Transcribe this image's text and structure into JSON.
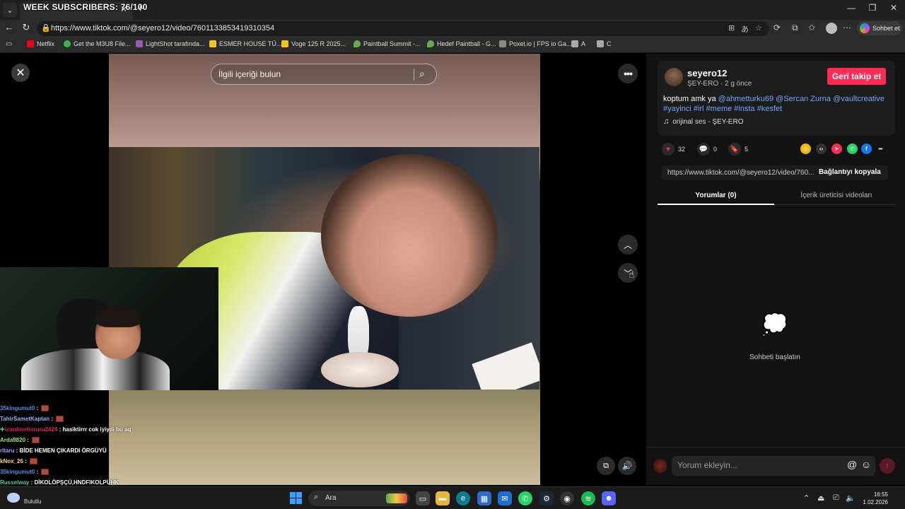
{
  "browser": {
    "overlay_title": "WEEK SUBSCRIBERS: 76/100",
    "new_tab": "+",
    "url": "https://www.tiktok.com/@seyero12/video/7601133853419310354",
    "copilot_label": "Sohbet et",
    "window_buttons": [
      "—",
      "❐",
      "✕"
    ],
    "bookmarks": [
      {
        "label": "Netflix",
        "color": "#e50914"
      },
      {
        "label": "Get the M3U8 File...",
        "color": "#3bb34a"
      },
      {
        "label": "LightShot tarafında...",
        "color": "#9b59b6"
      },
      {
        "label": "ESMER HOUSE TÜ...",
        "color": "#f5c518"
      },
      {
        "label": "Voge 125 R 2025...",
        "color": "#f5c518"
      },
      {
        "label": "Paintball Summit -...",
        "color": "#6aa84f"
      },
      {
        "label": "Hedef Paintball - G...",
        "color": "#6aa84f"
      },
      {
        "label": "Poxel.io | FPS io Ga...",
        "color": "#888888"
      },
      {
        "label": "A",
        "color": "#aaaaaa"
      },
      {
        "label": "C",
        "color": "#aaaaaa"
      }
    ]
  },
  "tiktok": {
    "search_placeholder": "İlgili içeriği bulun",
    "author": {
      "username": "seyero12",
      "subtitle": "ŞEY-ERO · 2 g önce",
      "follow_label": "Geri takip et"
    },
    "caption": {
      "text": "koptum amk ya",
      "mentions": [
        "@ahmetturku69",
        "@Sercan Zurna",
        "@vaultcreative"
      ],
      "hashtags": [
        "#yayinci",
        "#irl",
        "#meme",
        "#insta",
        "#kesfet"
      ]
    },
    "sound": "orijinal ses - ŞEY-ERO",
    "actions": {
      "likes": "32",
      "comments": "0",
      "saves": "5"
    },
    "link_url": "https://www.tiktok.com/@seyero12/video/760...",
    "copy_link_label": "Bağlantıyı kopyala",
    "tabs": [
      "Yorumlar (0)",
      "İçerik üreticisi videoları"
    ],
    "empty_comments_text": "Sohbeti başlatın",
    "comment_placeholder": "Yorum ekleyin...",
    "at_symbol": "@",
    "accent_color": "#fe2c55"
  },
  "stream_chat": [
    {
      "user": "35kingumut0",
      "color": "#4a90e2",
      "msg": "",
      "emote": true
    },
    {
      "user": "TahirSametKaptan",
      "color": "#8ab4f8",
      "msg": "",
      "emote": true
    },
    {
      "user": "icardinettoruru2424",
      "color": "#e0245e",
      "msg": "hasiktirrr cok iyiydi bu aq",
      "emote": false
    },
    {
      "user": "Arda9820",
      "color": "#9be564",
      "msg": "",
      "emote": true
    },
    {
      "user": "rltaru",
      "color": "#a0a0ff",
      "msg": "BİDE HEMEN ÇIKARDI ÖRGÜYÜ",
      "emote": false
    },
    {
      "user": "kNox_26",
      "color": "#f5d76e",
      "msg": "",
      "emote": true
    },
    {
      "user": "35kingumut0",
      "color": "#4a90e2",
      "msg": "",
      "emote": true
    },
    {
      "user": "Russelway",
      "color": "#3ecf8e",
      "msg": "DİKOLÖPŞÇÜ,HNDFIKOLPÜHK",
      "emote": false
    },
    {
      "user": "willowgyog",
      "color": "#dddddd",
      "msg": "",
      "emote": true
    }
  ],
  "taskbar": {
    "weather": "Bulutlu",
    "search_label": "Ara",
    "time": "16:55",
    "date": "1.02.2026"
  }
}
